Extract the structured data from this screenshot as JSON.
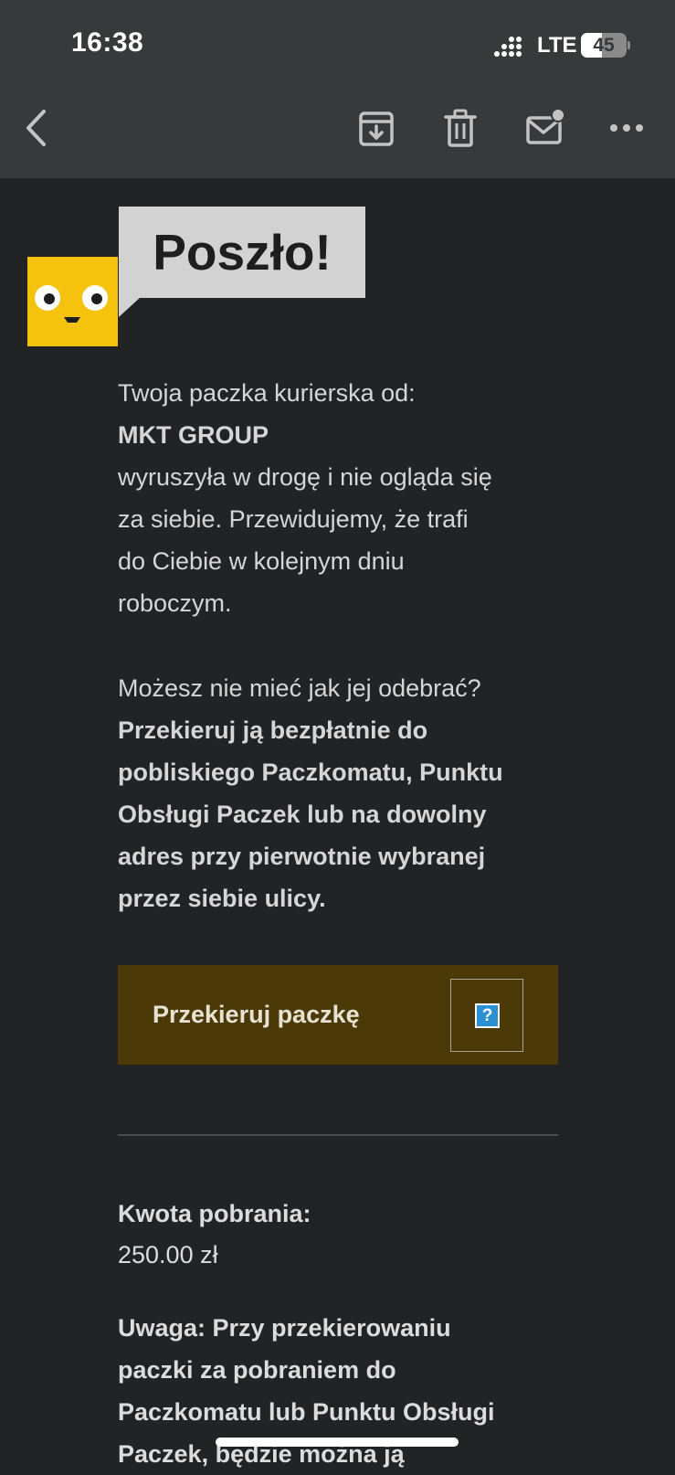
{
  "status_bar": {
    "time": "16:38",
    "network": "LTE",
    "battery": "45",
    "battery_level": 0.45
  },
  "toolbar": {
    "icons": [
      "back-icon",
      "archive-icon",
      "trash-icon",
      "mark-unread-icon",
      "more-icon"
    ]
  },
  "email": {
    "headline": "Poszło!",
    "intro": "Twoja paczka kurierska od:",
    "sender": "MKT GROUP",
    "message_lines": [
      "wyruszyła w drogę i nie ogląda się",
      "za siebie. Przewidujemy, że trafi",
      "do Ciebie w kolejnym dniu",
      "roboczym."
    ],
    "question": "Możesz nie mieć jak jej odebrać?",
    "redirect_lines": [
      "Przekieruj ją bezpłatnie do",
      "pobliskiego Paczkomatu, Punktu",
      "Obsługi Paczek lub na dowolny",
      "adres przy pierwotnie wybranej",
      "przez siebie ulicy."
    ],
    "button_label": "Przekieruj paczkę",
    "help_glyph": "?",
    "amount_label": "Kwota pobrania:",
    "amount_value": "250.00 zł",
    "note_lines": [
      "Uwaga: Przy przekierowaniu",
      "paczki za pobraniem do",
      "Paczkomatu lub Punktu Obsługi",
      "Paczek, będzie można ją"
    ]
  },
  "colors": {
    "background": "#222325",
    "toolbar": "#38393b",
    "mascot": "#f5c20d",
    "button": "#4b3908",
    "bubble": "#d2d2d2"
  }
}
